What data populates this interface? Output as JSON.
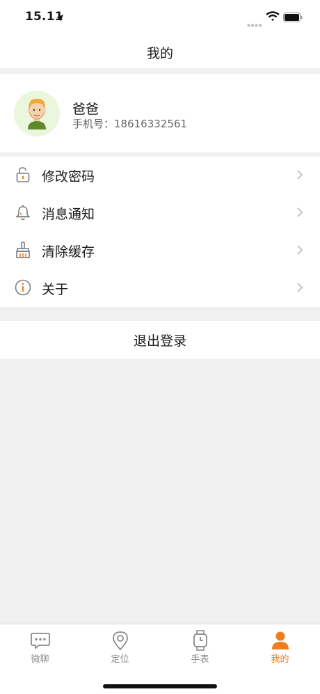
{
  "status": {
    "time": "15.11"
  },
  "nav": {
    "title": "我的"
  },
  "profile": {
    "name": "爸爸",
    "phone_label": "手机号：18616332561"
  },
  "menu": {
    "items": [
      {
        "label": "修改密码",
        "icon": "lock-icon"
      },
      {
        "label": "消息通知",
        "icon": "bell-icon"
      },
      {
        "label": "清除缓存",
        "icon": "broom-icon"
      },
      {
        "label": "关于",
        "icon": "info-icon"
      }
    ]
  },
  "logout": {
    "label": "退出登录"
  },
  "tabs": [
    {
      "label": "微聊",
      "icon": "chat-icon",
      "active": false
    },
    {
      "label": "定位",
      "icon": "location-icon",
      "active": false
    },
    {
      "label": "手表",
      "icon": "watch-icon",
      "active": false
    },
    {
      "label": "我的",
      "icon": "person-icon",
      "active": true
    }
  ],
  "colors": {
    "accent": "#f07c1e",
    "icon_gray": "#7d7d7d",
    "background": "#f0f0f0"
  }
}
